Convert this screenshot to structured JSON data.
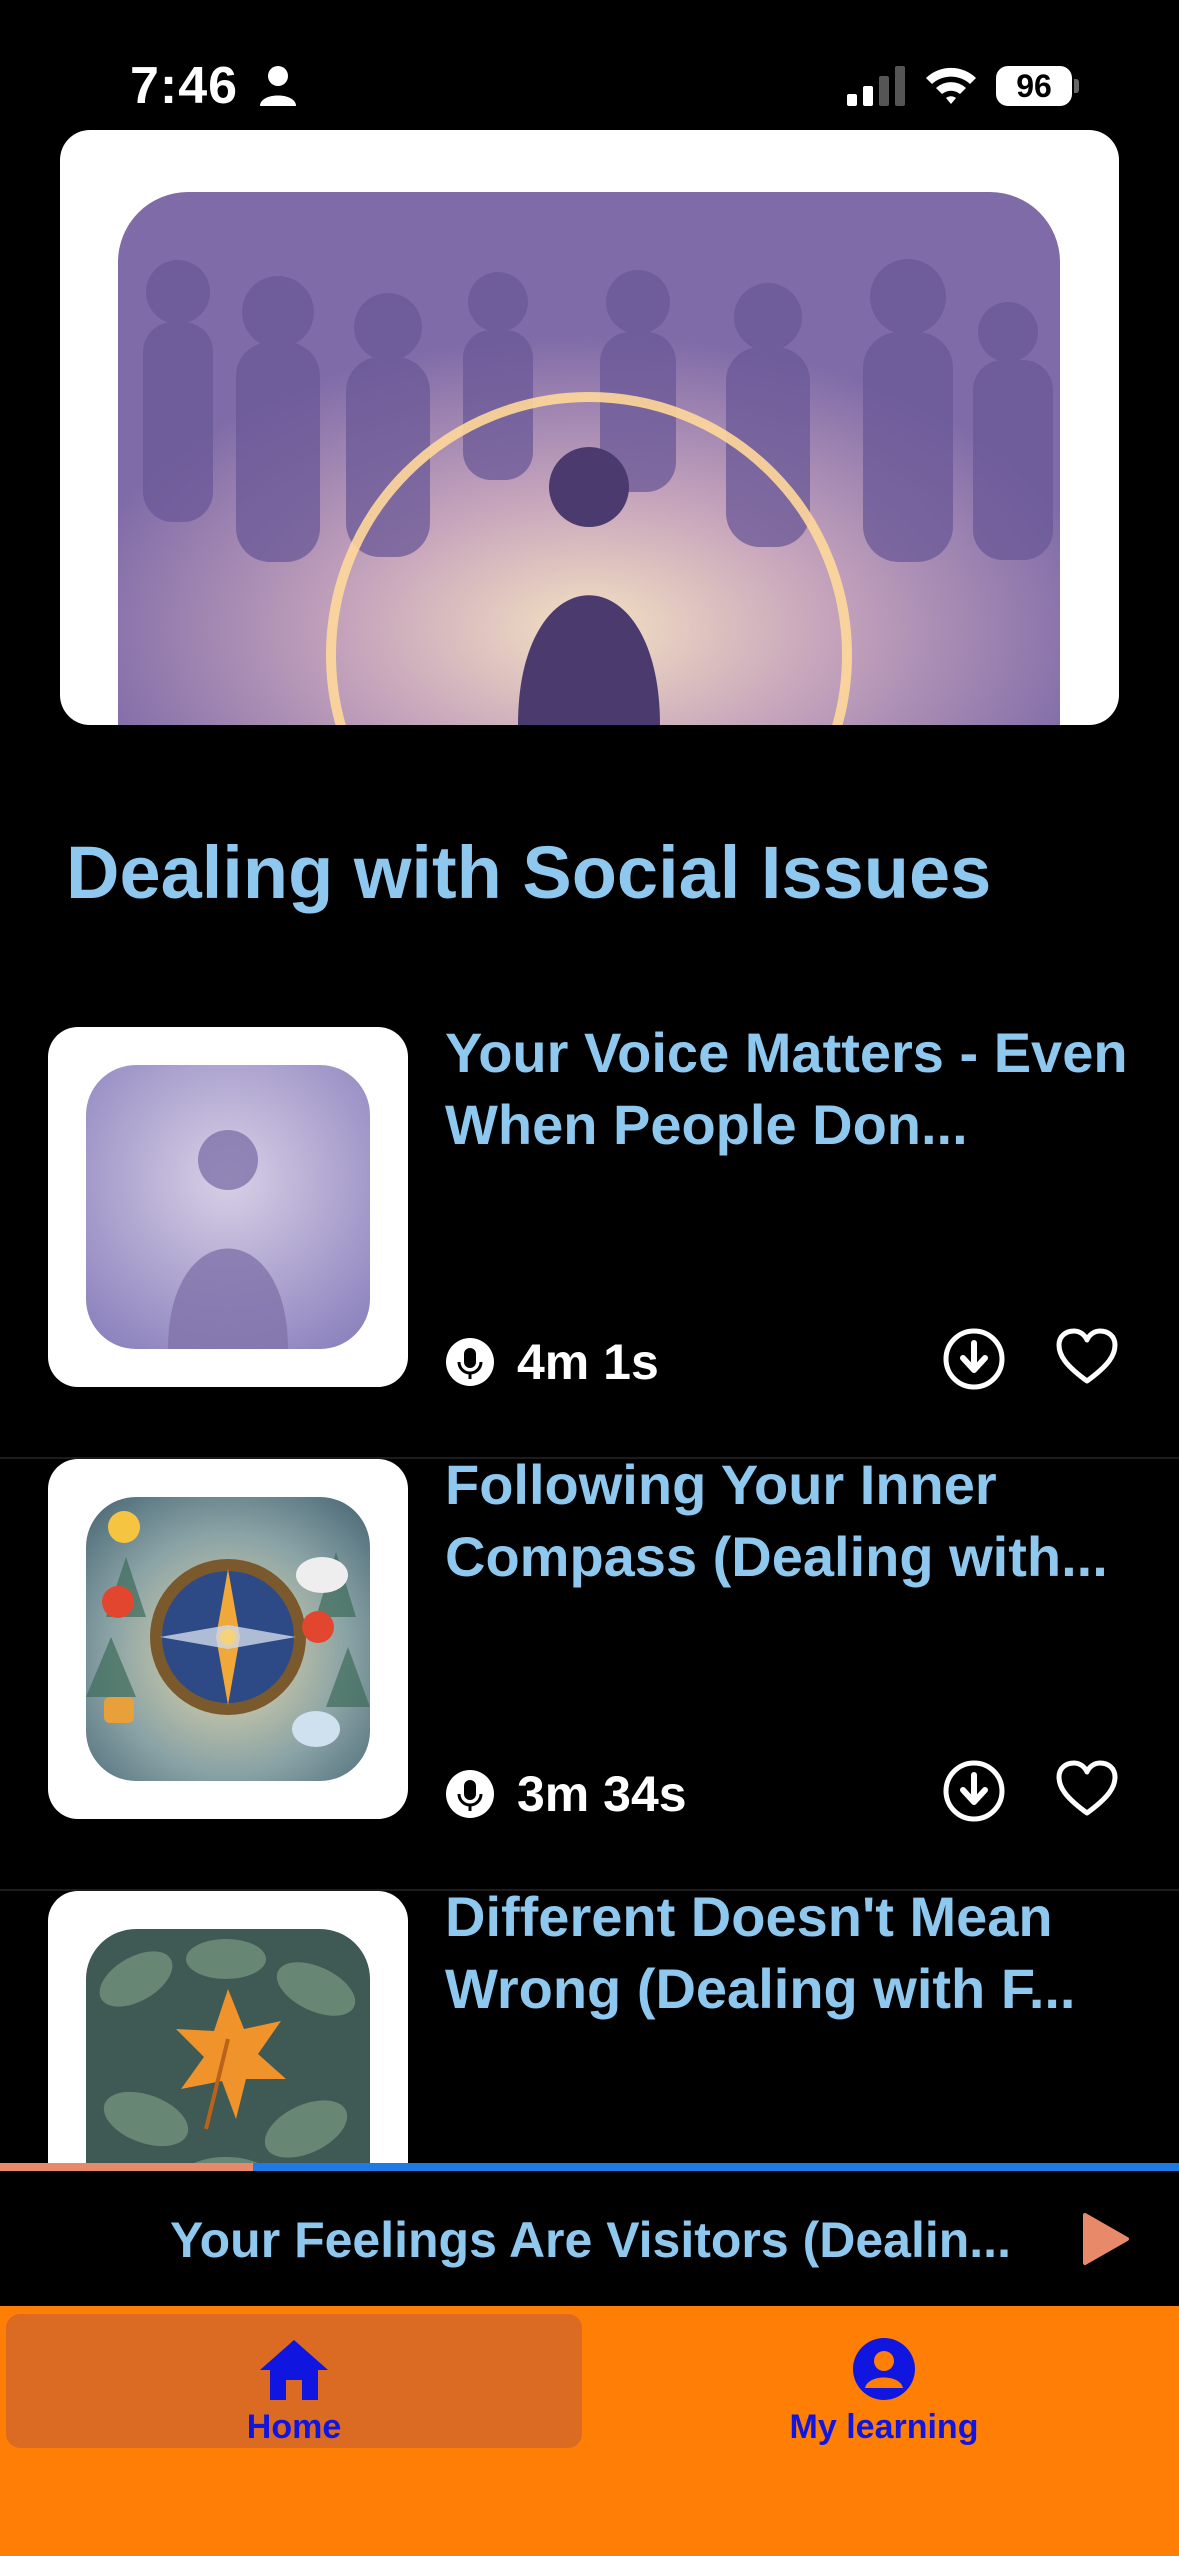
{
  "status_bar": {
    "time": "7:46",
    "battery": "96"
  },
  "hero": {
    "image_name": "social-crowd-spotlight-art"
  },
  "section": {
    "title": "Dealing with Social Issues"
  },
  "episodes": [
    {
      "title": "Your Voice Matters - Even When People Don...",
      "duration": "4m 1s",
      "thumbnail": "silhouette-in-haze-art"
    },
    {
      "title": "Following Your Inner Compass (Dealing with...",
      "duration": "3m 34s",
      "thumbnail": "compass-with-emojis-art"
    },
    {
      "title": "Different Doesn't Mean Wrong (Dealing with F...",
      "thumbnail": "orange-leaf-among-green-art"
    }
  ],
  "player": {
    "title": "Your Feelings Are Visitors (Dealin...",
    "progress": 0.215
  },
  "tabs": [
    {
      "label": "Home",
      "icon": "home-icon",
      "active": true
    },
    {
      "label": "My learning",
      "icon": "user-circle-icon",
      "active": false
    }
  ],
  "colors": {
    "accent_text": "#8ec8ef",
    "tab_bar": "#ff7f06",
    "tab_active": "#db6a23",
    "tab_label": "#1016e0",
    "progress_played": "#e8896a",
    "progress_track": "#1e7be6"
  }
}
